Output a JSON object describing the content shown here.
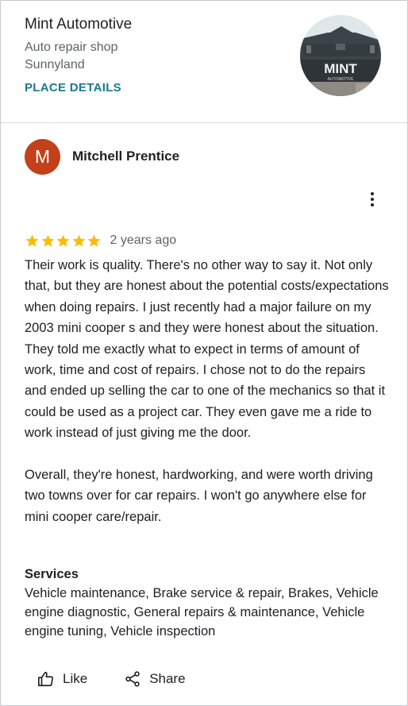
{
  "place": {
    "name": "Mint Automotive",
    "category": "Auto repair shop",
    "location": "Sunnyland",
    "details_link": "PLACE DETAILS",
    "photo_sign_text": "MINT",
    "photo_sign_subtext": "AUTOMOTIVE"
  },
  "review": {
    "avatar_initial": "M",
    "reviewer_name": "Mitchell Prentice",
    "rating": 5,
    "max_rating": 5,
    "time": "2 years ago",
    "paragraphs": [
      "Their work is quality. There's no other way to say it. Not only that, but they are honest about the potential costs/expectations when doing repairs. I just recently had a major failure on my 2003 mini cooper s and they were honest about the situation. They told me exactly what to expect in terms of amount of work, time and cost of repairs. I chose not to do the repairs and ended up selling the car to one of the mechanics so that it could be used as a project car. They even gave me a ride to work instead of just giving me the door.",
      "Overall, they're honest, hardworking, and were worth driving two towns over for car repairs. I won't go anywhere else for mini cooper care/repair."
    ],
    "services_title": "Services",
    "services_list": "Vehicle maintenance, Brake service & repair, Brakes, Vehicle engine diagnostic, General repairs & maintenance, Vehicle engine tuning, Vehicle inspection"
  },
  "actions": {
    "like_label": "Like",
    "share_label": "Share"
  },
  "colors": {
    "link": "#1a7a8c",
    "star": "#fbbc04",
    "avatar_bg": "#c2401a"
  },
  "icons": [
    "star-icon",
    "more-vert-icon",
    "thumb-up-icon",
    "share-icon"
  ]
}
